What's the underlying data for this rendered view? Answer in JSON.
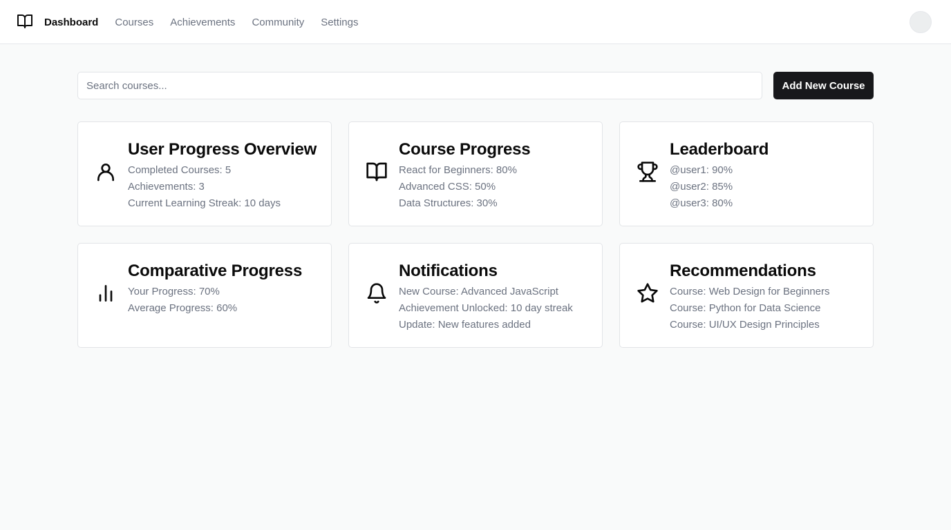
{
  "nav": {
    "items": [
      {
        "label": "Dashboard",
        "active": true
      },
      {
        "label": "Courses",
        "active": false
      },
      {
        "label": "Achievements",
        "active": false
      },
      {
        "label": "Community",
        "active": false
      },
      {
        "label": "Settings",
        "active": false
      }
    ]
  },
  "search": {
    "placeholder": "Search courses..."
  },
  "actions": {
    "add_label": "Add New Course"
  },
  "colors": {
    "primary_button": "#18181b",
    "background": "#f9fafa",
    "muted_text": "#6b7280"
  },
  "cards": [
    {
      "title": "User Progress Overview",
      "icon": "user-icon",
      "lines": [
        "Completed Courses: 5",
        "Achievements: 3",
        "Current Learning Streak: 10 days"
      ]
    },
    {
      "title": "Course Progress",
      "icon": "book-icon",
      "lines": [
        "React for Beginners: 80%",
        "Advanced CSS: 50%",
        "Data Structures: 30%"
      ]
    },
    {
      "title": "Leaderboard",
      "icon": "trophy-icon",
      "lines": [
        "@user1: 90%",
        "@user2: 85%",
        "@user3: 80%"
      ]
    },
    {
      "title": "Comparative Progress",
      "icon": "bar-chart-icon",
      "lines": [
        "Your Progress: 70%",
        "Average Progress: 60%"
      ]
    },
    {
      "title": "Notifications",
      "icon": "bell-icon",
      "lines": [
        "New Course: Advanced JavaScript",
        "Achievement Unlocked: 10 day streak",
        "Update: New features added"
      ]
    },
    {
      "title": "Recommendations",
      "icon": "star-icon",
      "lines": [
        "Course: Web Design for Beginners",
        "Course: Python for Data Science",
        "Course: UI/UX Design Principles"
      ]
    }
  ]
}
